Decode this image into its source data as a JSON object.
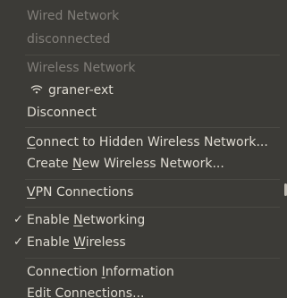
{
  "menu": {
    "wired_header": "Wired Network",
    "wired_status": "disconnected",
    "wireless_header": "Wireless Network",
    "wireless_ssid": "graner-ext",
    "wireless_ssid_icon": "wifi-signal-icon",
    "disconnect": "Disconnect",
    "connect_hidden_prefix": "C",
    "connect_hidden_rest": "onnect to Hidden Wireless Network...",
    "create_new_a": "Create ",
    "create_new_u": "N",
    "create_new_b": "ew Wireless Network...",
    "vpn_u": "V",
    "vpn_rest": "PN Connections",
    "enable_networking_a": "Enable ",
    "enable_networking_u": "N",
    "enable_networking_b": "etworking",
    "enable_wireless_a": "Enable ",
    "enable_wireless_u": "W",
    "enable_wireless_b": "ireless",
    "check_glyph": "✓",
    "conn_info_a": "Connection ",
    "conn_info_u": "I",
    "conn_info_b": "nformation",
    "edit_connections": "Edit Connections..."
  },
  "colors": {
    "menu_bg": "#3c3b37",
    "text_enabled": "#dfdbd2",
    "text_disabled": "#807d78",
    "separator": "#4a4944"
  }
}
